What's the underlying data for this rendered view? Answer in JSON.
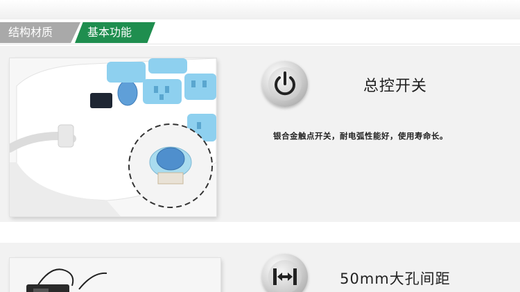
{
  "tabs": [
    {
      "label": "结构材质",
      "active": false
    },
    {
      "label": "基本功能",
      "active": true
    }
  ],
  "features": [
    {
      "title": "总控开关",
      "description": "银合金触点开关，耐电弧性能好，使用寿命长。",
      "icon": "power-icon"
    },
    {
      "title": "50mm大孔间距",
      "icon": "distance-icon"
    }
  ],
  "colors": {
    "active_tab": "#1f8e4f",
    "inactive_tab": "#a9a9a9",
    "socket_blue": "#8ed0ef",
    "switch_blue": "#5f9fd8"
  }
}
